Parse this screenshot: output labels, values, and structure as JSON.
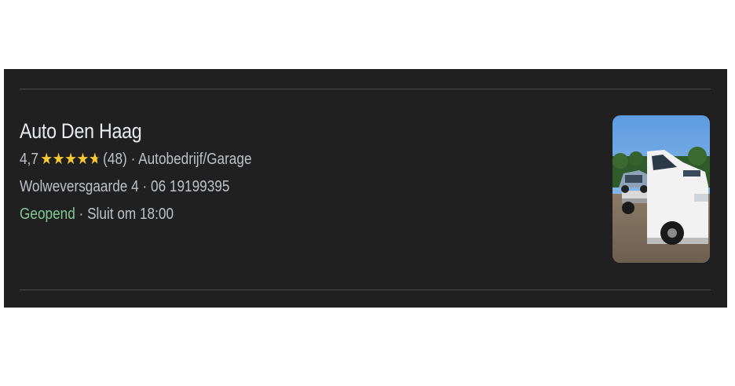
{
  "listing": {
    "name": "Auto Den Haag",
    "rating": "4,7",
    "rating_value": 4.7,
    "rating_max": 5,
    "review_count": "(48)",
    "category": "Autobedrijf/Garage",
    "address": "Wolweversgaarde 4",
    "phone": "06 19199395",
    "status_open": "Geopend",
    "hours": "Sluit om 18:00",
    "separator": "·",
    "star_icon": "star-icon",
    "thumbnail_icon": "tow-truck-photo",
    "colors": {
      "background": "#202020",
      "title": "#e8eaed",
      "text": "#bdc1c6",
      "star": "#fcc934",
      "open": "#81c995",
      "divider": "#4a4a4a"
    }
  }
}
